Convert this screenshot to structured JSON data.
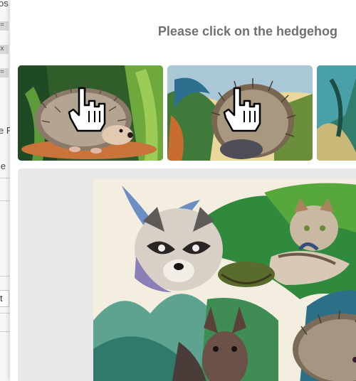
{
  "background_page": {
    "fragments": [
      "os",
      "=",
      "x",
      "=",
      "e F",
      "ie",
      "t"
    ]
  },
  "dialog": {
    "prompt": "Please click on the hedgehog"
  },
  "thumbnails": [
    {
      "subject": "hedgehog",
      "cursor_icon": "hand-pointer-icon"
    },
    {
      "subject": "hedgehog",
      "cursor_icon": "hand-pointer-icon"
    },
    {
      "subject": "hedgehog-partial"
    }
  ],
  "main_image": {
    "subjects": [
      "raccoon",
      "cat",
      "bat",
      "hedgehog"
    ]
  }
}
